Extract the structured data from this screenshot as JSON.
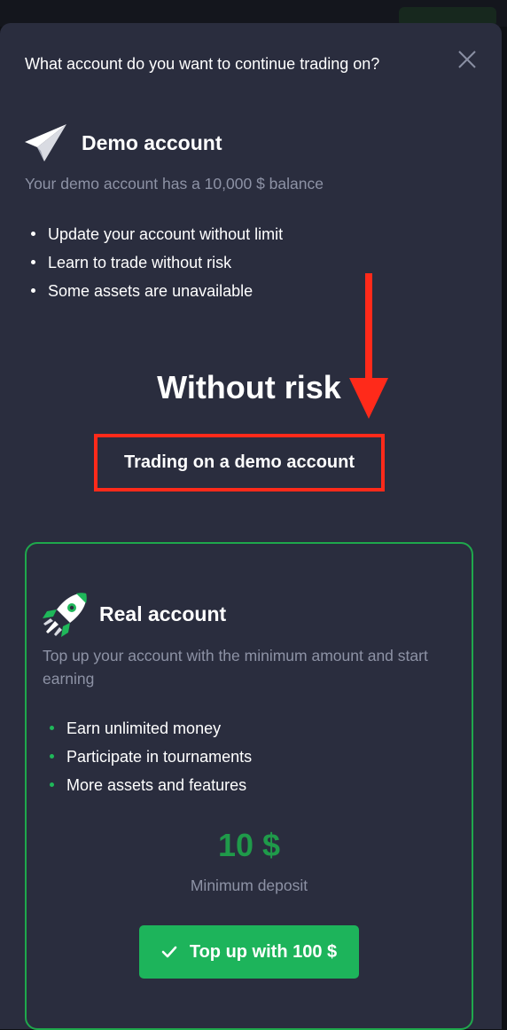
{
  "modal": {
    "title": "What account do you want to continue trading on?",
    "close_icon": "close-icon"
  },
  "demo": {
    "icon": "paper-plane-icon",
    "heading": "Demo account",
    "description": "Your demo account has a 10,000 $ balance",
    "features": [
      "Update your account without limit",
      "Learn to trade without risk",
      "Some assets are unavailable"
    ],
    "tagline": "Without risk",
    "cta_label": "Trading on a demo account"
  },
  "real": {
    "icon": "rocket-icon",
    "heading": "Real account",
    "description": "Top up your account with the minimum amount and start earning",
    "features": [
      "Earn unlimited money",
      "Participate in tournaments",
      "More assets and features"
    ],
    "deposit_amount": "10 $",
    "deposit_caption": "Minimum deposit",
    "cta_label": "Top up with 100 $",
    "cta_icon": "checkmark-icon"
  },
  "colors": {
    "background": "#2a2d3e",
    "accent_green": "#1db45b",
    "annotation_red": "#ff2a1a",
    "muted_text": "#8d92a5"
  }
}
